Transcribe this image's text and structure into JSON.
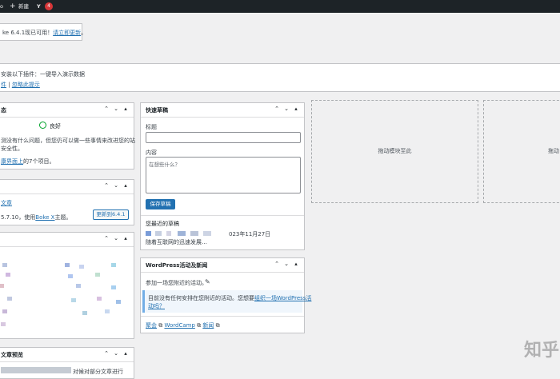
{
  "adminbar": {
    "new_label": "新建",
    "update_count": "4"
  },
  "update_notice": {
    "text": "ke 6.4.1现已可用！",
    "link": "请立即更新"
  },
  "plugin_notice": {
    "line1": "安装以下插件：一键导入演示数据",
    "link1": "件",
    "sep": "|",
    "link2": "忽略此提示"
  },
  "site_health": {
    "title": "态",
    "status": "良好",
    "desc1": "测没有什么问题，但您仍可以做一些事情来改进您的站",
    "desc2": "安全性。",
    "link": "康界面上",
    "link_tail": "的7个项目。"
  },
  "at_glance": {
    "line1": "文章",
    "version_prefix": "5.7.10，使用",
    "theme_link": "Boke X",
    "theme_suffix": "主题。",
    "update_button": "更新到6.4.1"
  },
  "preview": {
    "title": "文章预览",
    "tail": "对候对部分文章进行"
  },
  "quick_draft": {
    "title": "快速草稿",
    "title_label": "标题",
    "content_label": "内容",
    "content_placeholder": "在想些什么？",
    "save_button": "保存草稿",
    "recent_heading": "您最近的草稿",
    "draft_date": "023年11月27日",
    "draft_excerpt": "随着互联网的迅速发展…"
  },
  "events": {
    "title": "WordPress活动及新闻",
    "attend": "参加一场您附近的活动。",
    "none_text": "目前没有任何安排在您附近的活动。您想要",
    "none_link": "组织一场WordPress活",
    "none_link2": "动吗？",
    "footer": [
      "聚会",
      "WordCamp",
      "新闻"
    ]
  },
  "dropzones": {
    "label1": "拖动模块至此",
    "label2": "拖动"
  },
  "watermark": "知乎"
}
